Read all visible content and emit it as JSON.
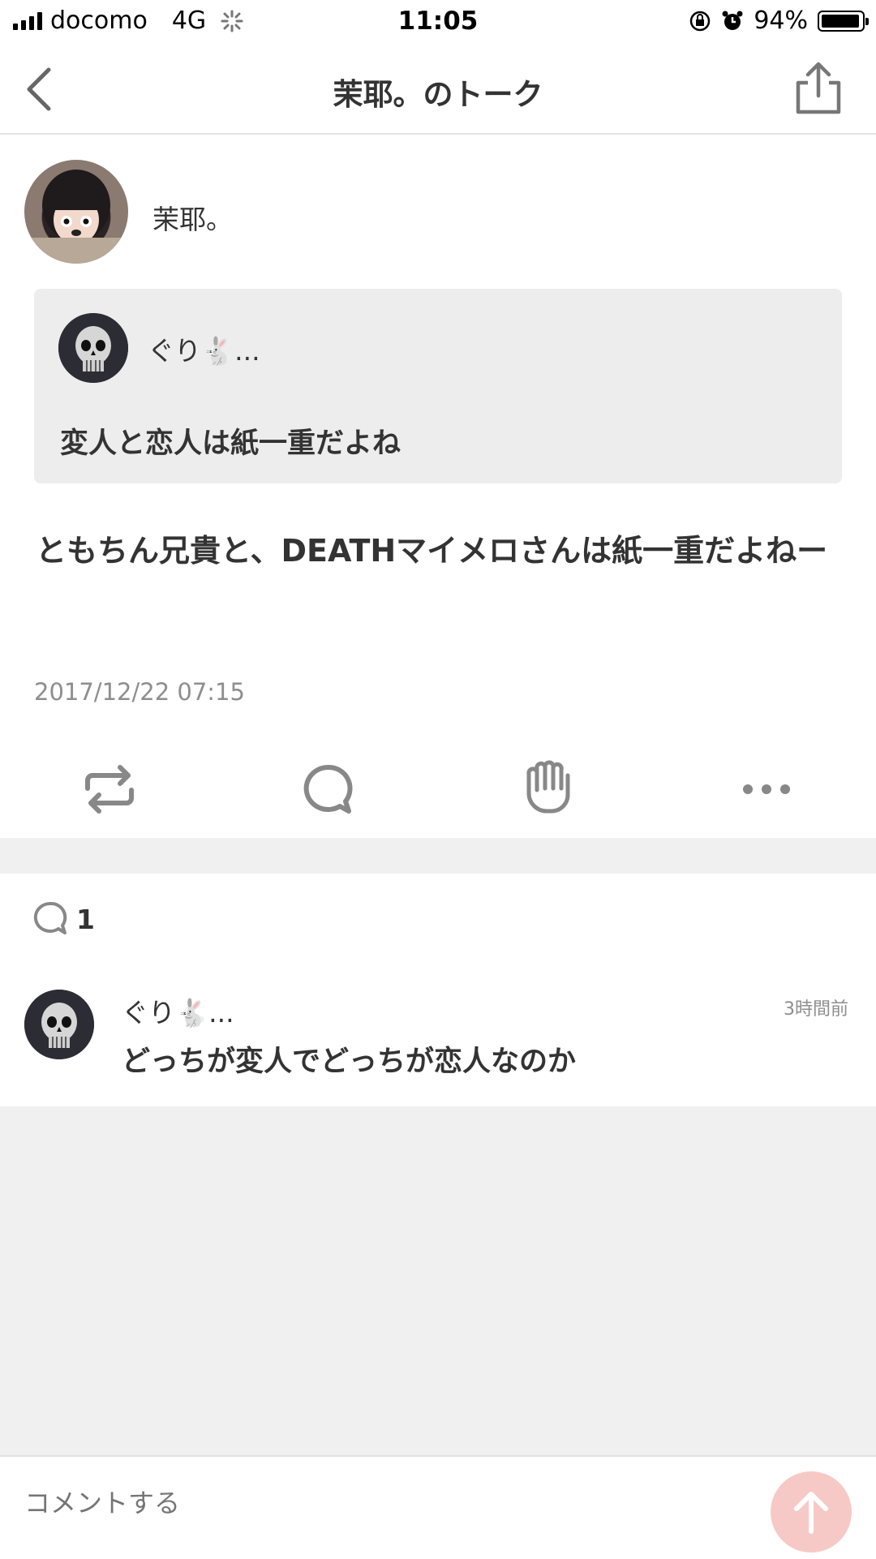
{
  "status_bar": {
    "carrier": "docomo",
    "network": "4G",
    "time": "11:05",
    "battery": "94%"
  },
  "nav": {
    "title": "茉耶。のトーク",
    "back_icon": "chevron-left-icon",
    "share_icon": "share-icon"
  },
  "post": {
    "author": "茉耶。",
    "quote": {
      "author": "ぐり🐇...",
      "text": "変人と恋人は紙一重だよね"
    },
    "text": "ともちん兄貴と、DEATHマイメロさんは紙一重だよねー",
    "date": "2017/12/22 07:15"
  },
  "actions": [
    "repost-icon",
    "comment-icon",
    "clap-icon",
    "more-icon"
  ],
  "comments": {
    "count": "1",
    "items": [
      {
        "author": "ぐり🐇...",
        "time": "3時間前",
        "text": "どっちが変人でどっちが恋人なのか"
      }
    ]
  },
  "composer": {
    "placeholder": "コメントする"
  },
  "colors": {
    "accent": "#f7c9c6",
    "band": "#f0f0f0",
    "text": "#333333",
    "muted": "#8e8e8e"
  }
}
